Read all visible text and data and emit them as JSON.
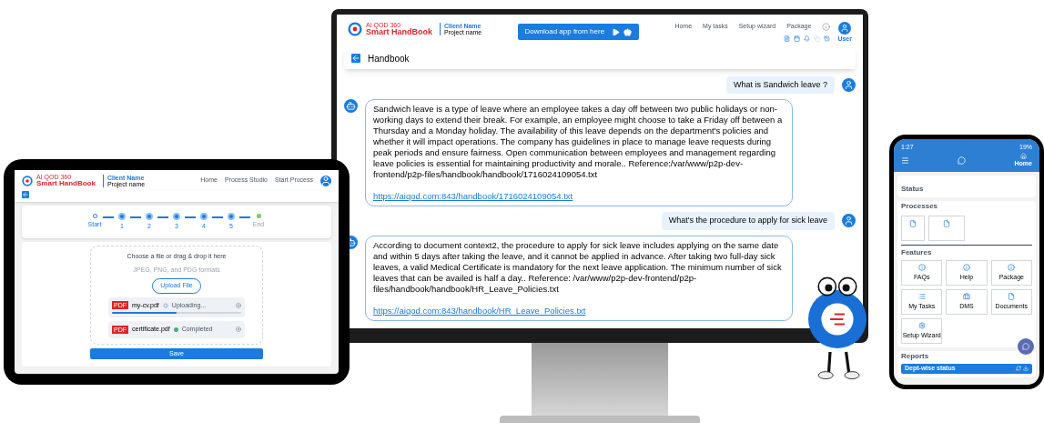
{
  "tablet": {
    "header": {
      "brand_top": "AI QOD 360",
      "brand": "Smart HandBook",
      "client": "Client Name",
      "project": "Project name",
      "nav": [
        "Home",
        "Process Studio",
        "Start Process"
      ]
    },
    "stepper": [
      {
        "label": "Start",
        "kind": "start"
      },
      {
        "label": "1",
        "kind": "step"
      },
      {
        "label": "2",
        "kind": "step"
      },
      {
        "label": "3",
        "kind": "step"
      },
      {
        "label": "4",
        "kind": "step"
      },
      {
        "label": "5",
        "kind": "step"
      },
      {
        "label": "End",
        "kind": "end"
      }
    ],
    "upload": {
      "title": "Choose a file or drag & drop it here",
      "formats": "JPEG, PNG, and PDG formats",
      "button": "Upload File"
    },
    "files": [
      {
        "name": "my-cv.pdf",
        "badge": "PDF",
        "status": "Uploading...",
        "kind": "uploading",
        "level": 0.5
      },
      {
        "name": "certificate.pdf",
        "badge": "PDF",
        "status": "Completed",
        "kind": "done"
      }
    ],
    "save": "Save"
  },
  "monitor": {
    "header": {
      "brand_top": "AI QOD 360",
      "brand": "Smart HandBook",
      "client": "Client Name",
      "project": "Project name",
      "download": "Download app from here",
      "nav": [
        "Home",
        "My tasks",
        "Setup wizard",
        "Package"
      ],
      "user": "User"
    },
    "page_title": "Handbook",
    "messages": [
      {
        "kind": "question",
        "text": "What is Sandwich leave ?"
      },
      {
        "kind": "answer",
        "text": "Sandwich leave is a type of leave where an employee takes a day off between two public holidays or non-working days to extend their break. For example, an employee might choose to take a Friday off between a Thursday and a Monday holiday. The availability of this leave depends on the department's policies and whether it will impact operations. The company has guidelines in place to manage leave requests during peak periods and ensure fairness. Open communication between employees and management regarding leave policies is essential for maintaining productivity and morale.. Reference:/var/www/p2p-dev-frontend/p2p-files/handbook/handbook/1716024109054.txt",
        "link": "https://aiqod.com:843/handbook/1716024109054.txt"
      },
      {
        "kind": "question",
        "text": "What's the procedure to apply for sick leave"
      },
      {
        "kind": "answer",
        "text": "According to document context2, the procedure to apply for sick leave includes applying on the same date and within 5 days after taking the leave, and it cannot be applied in advance. After taking two full-day sick leaves, a valid Medical Certificate is mandatory for the next leave application. The minimum number of sick leaves that can be availed is half a day.. Reference: /var/www/p2p-dev-frontend/p2p-files/handbook/handbook/HR_Leave_Policies.txt",
        "link": "https://aiqod.com:843/handbook/HR_Leave_Policies.txt"
      }
    ]
  },
  "phone": {
    "status_bar": {
      "time": "1:27",
      "battery": "19%"
    },
    "home": "Home",
    "status_title": "Status",
    "processes_title": "Processes",
    "features_title": "Features",
    "features": [
      {
        "label": "FAQs",
        "kind": "info"
      },
      {
        "label": "Help",
        "kind": "help"
      },
      {
        "label": "Package",
        "kind": "help"
      },
      {
        "label": "My Tasks",
        "kind": "list"
      },
      {
        "label": "DMS",
        "kind": "briefcase"
      },
      {
        "label": "Documents",
        "kind": "doc"
      },
      {
        "label": "Setup Wizard",
        "kind": "gear"
      }
    ],
    "reports_title": "Reports",
    "report": "Dept-wise status"
  }
}
